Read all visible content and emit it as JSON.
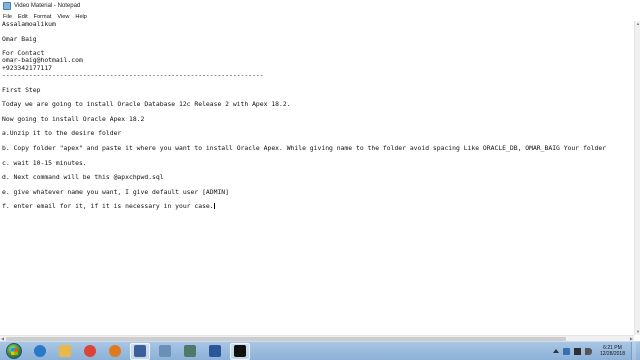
{
  "window": {
    "title": "Video Material - Notepad",
    "app_icon": "notepad-icon"
  },
  "menu": {
    "items": [
      "File",
      "Edit",
      "Format",
      "View",
      "Help"
    ]
  },
  "document": {
    "lines": [
      "Assalamoalikum",
      "",
      "Omar Baig",
      "",
      "For Contact",
      "omar-baig@hotmail.com",
      "+923342177117",
      "--------------------------------------------------------------------",
      "",
      "First Step",
      "",
      "Today we are going to install Oracle Database 12c Release 2 with Apex 18.2.",
      "",
      "Now going to install Oracle Apex 18.2",
      "",
      "a.Unzip it to the desire folder",
      "",
      "b. Copy folder \"apex\" and paste it where you want to install Oracle Apex. While giving name to the folder avoid spacing Like ORACLE_DB, OMAR_BAIG Your folder",
      "",
      "c. wait 10-15 minutes.",
      "",
      "d. Next command will be this @apxchpwd.sql",
      "",
      "e. give whatever name you want, I give default user [ADMIN]",
      "",
      "f. enter email for it, if it is necessary in your case."
    ]
  },
  "taskbar": {
    "start_icon": "windows-start-icon",
    "apps": [
      {
        "icon": "internet-explorer-icon",
        "color": "#2a78c8"
      },
      {
        "icon": "file-explorer-icon",
        "color": "#e8b84a"
      },
      {
        "icon": "chrome-icon",
        "color": "#db4437"
      },
      {
        "icon": "media-player-icon",
        "color": "#e07a1f"
      },
      {
        "icon": "tool-icon",
        "color": "#3a5f9a"
      },
      {
        "icon": "network-icon",
        "color": "#6a8fb8"
      },
      {
        "icon": "desktop-app-icon",
        "color": "#4f7a6a"
      },
      {
        "icon": "word-icon",
        "color": "#2b579a"
      },
      {
        "icon": "command-prompt-icon",
        "color": "#111111"
      }
    ],
    "clock": {
      "time": "6:21 PM",
      "date": "12/28/2018"
    }
  }
}
